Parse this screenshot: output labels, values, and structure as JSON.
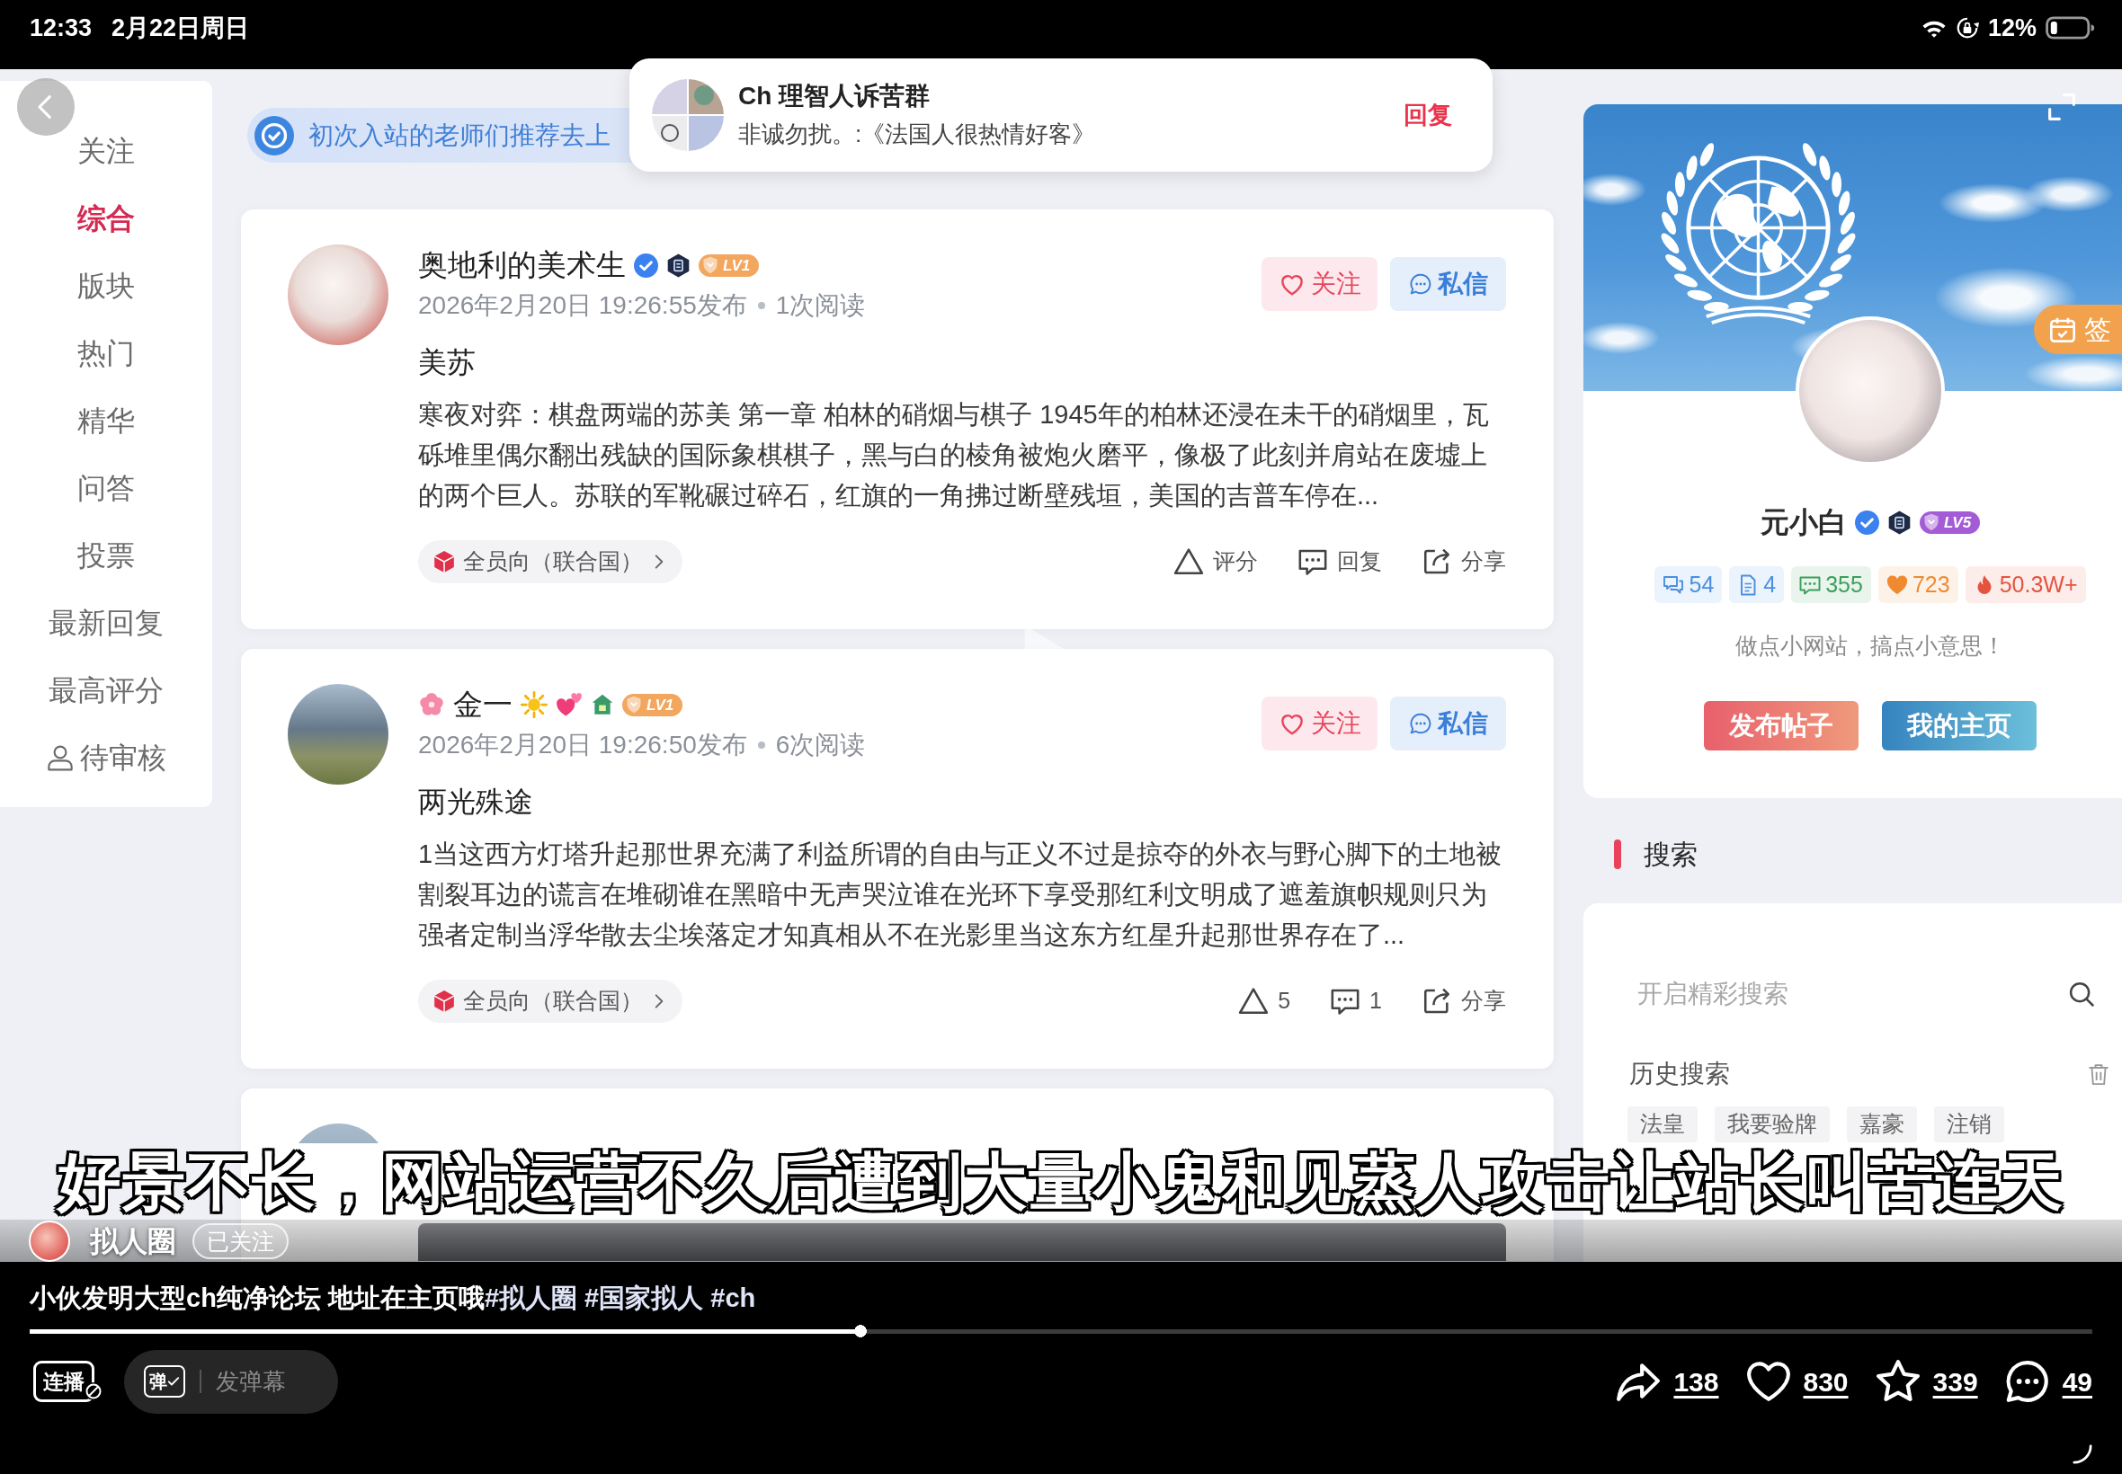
{
  "status_bar": {
    "time": "12:33",
    "date": "2月22日周日",
    "battery": "12%"
  },
  "notification": {
    "title": "Ch 理智人诉苦群",
    "message": "非诚勿扰。:《法国人很热情好客》",
    "action": "回复"
  },
  "site": {
    "sidebar": {
      "items": [
        {
          "label": "关注",
          "selected": false,
          "kind": "text"
        },
        {
          "label": "综合",
          "selected": true,
          "kind": "text"
        },
        {
          "label": "版块",
          "selected": false,
          "kind": "text"
        },
        {
          "label": "热门",
          "selected": false,
          "kind": "text"
        },
        {
          "label": "精华",
          "selected": false,
          "kind": "text"
        },
        {
          "label": "问答",
          "selected": false,
          "kind": "text"
        },
        {
          "label": "投票",
          "selected": false,
          "kind": "text"
        },
        {
          "label": "最新回复",
          "selected": false,
          "kind": "text"
        },
        {
          "label": "最高评分",
          "selected": false,
          "kind": "text"
        },
        {
          "label": "待审核",
          "selected": false,
          "kind": "user"
        }
      ]
    },
    "notice": {
      "text": "初次入站的老师们推荐去上"
    },
    "posts": [
      {
        "kind": "text",
        "author": {
          "name": "奥地利的美术生",
          "badges": [
            {
              "kind": "verified"
            },
            {
              "kind": "shield"
            },
            {
              "kind": "level",
              "text": "LV1",
              "color": "#f2a65e"
            }
          ]
        },
        "date": "2026年2月20日 19:26:55发布",
        "views": "1次阅读",
        "follow": "关注",
        "message": "私信",
        "title": "美苏",
        "excerpt": "寒夜对弈：棋盘两端的苏美 第一章 柏林的硝烟与棋子 1945年的柏林还浸在未干的硝烟里，瓦砾堆里偶尔翻出残缺的国际象棋棋子，黑与白的棱角被炮火磨平，像极了此刻并肩站在废墟上的两个巨人。苏联的军靴碾过碎石，红旗的一角拂过断壁残垣，美国的吉普车停在...",
        "tag": "全员向（联合国）",
        "actions": [
          {
            "kind": "rate",
            "label": "评分"
          },
          {
            "kind": "reply",
            "label": "回复"
          },
          {
            "kind": "share",
            "label": "分享"
          }
        ]
      },
      {
        "kind": "text",
        "author": {
          "name": "金一",
          "prefix": [
            {
              "kind": "flower"
            }
          ],
          "badges": [
            {
              "kind": "sun"
            },
            {
              "kind": "hearts"
            },
            {
              "kind": "house"
            },
            {
              "kind": "level",
              "text": "LV1",
              "color": "#f2a65e"
            }
          ]
        },
        "date": "2026年2月20日 19:26:50发布",
        "views": "6次阅读",
        "follow": "关注",
        "message": "私信",
        "title": "两光殊途",
        "excerpt": "1当这西方灯塔升起那世界充满了利益所谓的自由与正义不过是掠夺的外衣与野心脚下的土地被割裂耳边的谎言在堆砌谁在黑暗中无声哭泣谁在光环下享受那红利文明成了遮羞旗帜规则只为强者定制当浮华散去尘埃落定才知真相从不在光影里当这东方红星升起那世界存在了...",
        "tag": "全员向（联合国）",
        "actions": [
          {
            "kind": "rate",
            "label": "5"
          },
          {
            "kind": "reply",
            "label": "1"
          },
          {
            "kind": "share",
            "label": "分享"
          }
        ]
      },
      {
        "kind": "media"
      }
    ],
    "profile": {
      "checkin": "签",
      "name": "元小白",
      "badges": [
        {
          "kind": "verified"
        },
        {
          "kind": "shield"
        },
        {
          "kind": "level",
          "text": "LV5",
          "color": "#a35cd6"
        }
      ],
      "stats": [
        {
          "kind": "comments",
          "value": "54",
          "color": "#4a8fe0"
        },
        {
          "kind": "documents",
          "value": "4",
          "color": "#4a8fe0"
        },
        {
          "kind": "messages",
          "value": "355",
          "color": "#3a9f5a"
        },
        {
          "kind": "likes",
          "value": "723",
          "color": "#f08a30"
        },
        {
          "kind": "heat",
          "value": "50.3W+",
          "color": "#e5533f"
        }
      ],
      "bio": "做点小网站，搞点小意思！",
      "buttons": [
        {
          "label": "发布帖子",
          "kind": "publish"
        },
        {
          "label": "我的主页",
          "kind": "home"
        }
      ]
    },
    "search": {
      "heading": "搜索",
      "placeholder": "开启精彩搜索",
      "history_label": "历史搜索",
      "history": [
        "法皇",
        "我要验牌",
        "嘉豪",
        "注销"
      ]
    }
  },
  "subtitle": "好景不长，网站运营不久后遭到大量小鬼和见蒸人攻击让站长叫苦连天",
  "author": {
    "name": "拟人圈",
    "follow": "已关注"
  },
  "caption": {
    "text": "小伙发明大型ch纯净论坛 地址在主页哦",
    "hashtags": [
      "#拟人圈",
      "#国家拟人",
      "#ch"
    ]
  },
  "progress": {
    "level": 0.403
  },
  "controls": {
    "autoplay": "连播",
    "danmaku_toggle": "弹",
    "danmaku_placeholder": "发弹幕"
  },
  "actions": [
    {
      "kind": "share",
      "count": "138"
    },
    {
      "kind": "like",
      "count": "830"
    },
    {
      "kind": "favorite",
      "count": "339"
    },
    {
      "kind": "comment",
      "count": "49"
    }
  ]
}
